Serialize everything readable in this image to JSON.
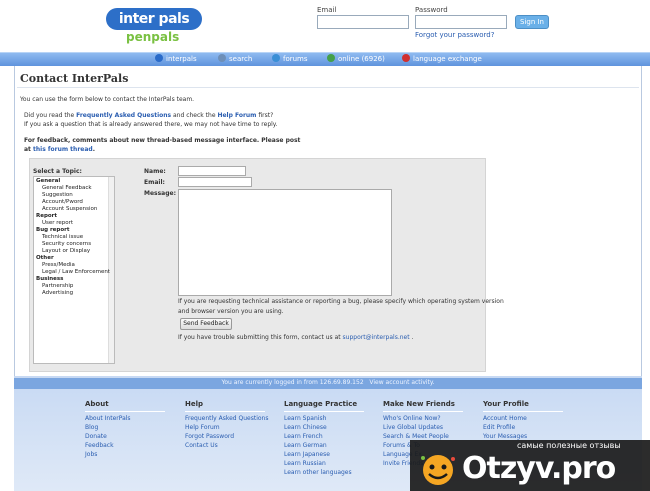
{
  "header": {
    "logo": {
      "top": "inter pals",
      "bottom": "penpals"
    },
    "email_label": "Email",
    "password_label": "Password",
    "signin_label": "Sign In",
    "forgot_label": "Forgot your password?"
  },
  "nav": {
    "items": [
      {
        "label": "interpals",
        "icon": "globe-icon",
        "color": "#2a6bc9"
      },
      {
        "label": "search",
        "icon": "search-icon",
        "color": "#6e8fb8"
      },
      {
        "label": "forums",
        "icon": "forum-icon",
        "color": "#3b8fd6"
      },
      {
        "label": "online (6926)",
        "icon": "online-icon",
        "color": "#44a04a"
      },
      {
        "label": "language exchange",
        "icon": "flag-icon",
        "color": "#d03030"
      }
    ]
  },
  "page": {
    "title": "Contact InterPals",
    "intro": "You can use the form below to contact the InterPals team.",
    "q_prefix": "Did you read the ",
    "q_faq": "Frequently Asked Questions",
    "q_mid": " and check the ",
    "q_forum": "Help Forum",
    "q_suffix": " first?",
    "warn": "If you ask a question that is already answered there, we may not have time to reply.",
    "feedback_line1": "For feedback, comments about new thread-based message interface. Please post",
    "feedback_at": "at ",
    "feedback_link": "this forum thread",
    "feedback_dot": "."
  },
  "form": {
    "topic_label": "Select a Topic:",
    "topics": [
      {
        "label": "General",
        "group": true
      },
      {
        "label": "General Feedback",
        "group": false
      },
      {
        "label": "Suggestion",
        "group": false
      },
      {
        "label": "Account/Pword",
        "group": false
      },
      {
        "label": "Account Suspension",
        "group": false
      },
      {
        "label": "Report",
        "group": true
      },
      {
        "label": "User report",
        "group": false
      },
      {
        "label": "Bug report",
        "group": true
      },
      {
        "label": "Technical issue",
        "group": false
      },
      {
        "label": "Security concerns",
        "group": false
      },
      {
        "label": "Layout or Display",
        "group": false
      },
      {
        "label": "Other",
        "group": true
      },
      {
        "label": "Press/Media",
        "group": false
      },
      {
        "label": "Legal / Law Enforcement",
        "group": false
      },
      {
        "label": "Business",
        "group": true
      },
      {
        "label": "Partnership",
        "group": false
      },
      {
        "label": "Advertising",
        "group": false
      }
    ],
    "name_label": "Name:",
    "email_label": "Email:",
    "email_value": "",
    "message_label": "Message:",
    "tech_note1": "If you are requesting technical assistance or reporting a bug, please specify which operating system version",
    "tech_note2": "and browser version you are using.",
    "send_label": "Send Feedback",
    "trouble_prefix": "If you have trouble submitting this form, contact us at ",
    "trouble_email": "support@interpals.net",
    "trouble_suffix": " ."
  },
  "footer": {
    "logged_in": "You are currently logged in from 126.69.89.152",
    "view_activity": "View account activity.",
    "columns": [
      {
        "heading": "About",
        "links": [
          "About InterPals",
          "Blog",
          "Donate",
          "Feedback",
          "Jobs"
        ]
      },
      {
        "heading": "Help",
        "links": [
          "Frequently Asked Questions",
          "Help Forum",
          "Forgot Password",
          "Contact Us"
        ]
      },
      {
        "heading": "Language Practice",
        "links": [
          "Learn Spanish",
          "Learn Chinese",
          "Learn French",
          "Learn German",
          "Learn Japanese",
          "Learn Russian",
          "Learn other languages"
        ]
      },
      {
        "heading": "Make New Friends",
        "links": [
          "Who's Online Now?",
          "Live Global Updates",
          "Search & Meet People",
          "Forums & To",
          "Language Ex",
          "Invite Friends"
        ]
      },
      {
        "heading": "Your Profile",
        "links": [
          "Account Home",
          "Edit Profile",
          "Your Messages"
        ]
      }
    ]
  },
  "watermark": {
    "top": "самые полезные отзывы",
    "text": "Otzyv.pro"
  }
}
